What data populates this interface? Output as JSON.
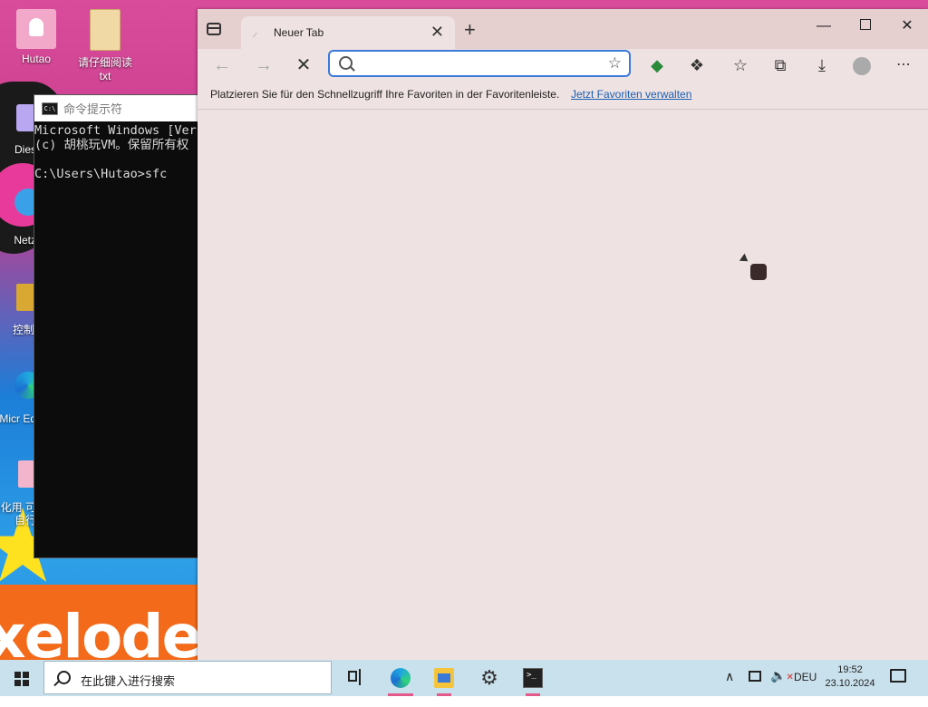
{
  "desktop": {
    "icons": [
      {
        "label": "Hutao"
      },
      {
        "label": "请仔细阅读txt"
      },
      {
        "label": "Dies"
      },
      {
        "label": "Netz"
      },
      {
        "label": "控制"
      },
      {
        "label": "Micr Ed"
      },
      {
        "label": "美化用 可自行"
      }
    ]
  },
  "cmd": {
    "title": "命令提示符",
    "lines": [
      "Microsoft Windows [Vers",
      "(c) 胡桃玩VM。保留所有权",
      "",
      "C:\\Users\\Hutao>sfc"
    ]
  },
  "browser": {
    "tab_title": "Neuer Tab",
    "address_value": "",
    "favorites_bar_message": "Platzieren Sie für den Schnellzugriff Ihre Favoriten in der Favoritenleiste.",
    "favorites_bar_link": "Jetzt Favoriten verwalten",
    "accent_color": "#3b7ad9",
    "link_color": "#1a5fb4"
  },
  "taskbar": {
    "search_placeholder": "在此键入进行搜索",
    "language": "DEU",
    "time": "19:52",
    "date": "23.10.2024",
    "accent_color": "#e35a8a",
    "apps": [
      "task-view-icon",
      "edge-icon",
      "file-explorer-icon",
      "settings-icon",
      "terminal-icon"
    ]
  }
}
